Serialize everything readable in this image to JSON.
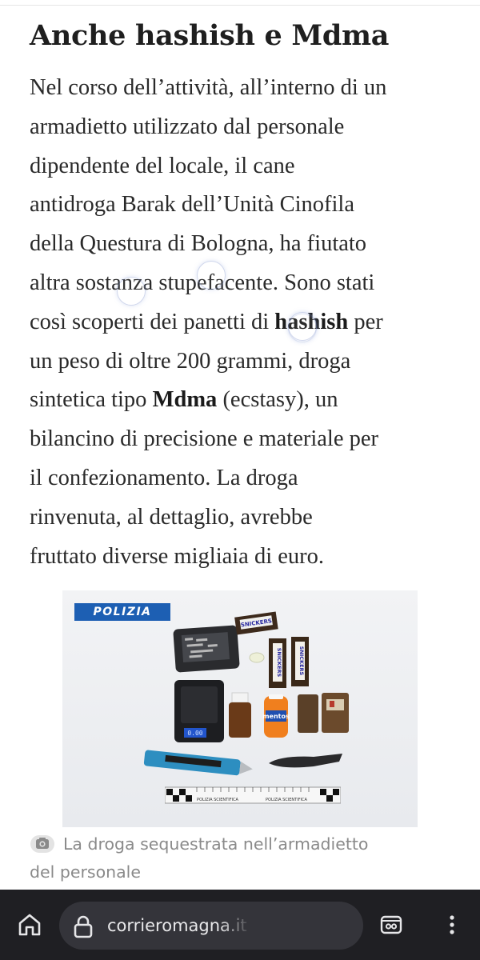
{
  "article": {
    "headline": "Anche hashish e Mdma",
    "lines": [
      {
        "parts": [
          {
            "t": "Nel corso dell’attività, all’interno di un"
          }
        ]
      },
      {
        "parts": [
          {
            "t": "armadietto utilizzato dal personale"
          }
        ]
      },
      {
        "parts": [
          {
            "t": "dipendente del locale, il cane"
          }
        ]
      },
      {
        "parts": [
          {
            "t": "antidroga Barak dell’Unità Cinofila"
          }
        ]
      },
      {
        "parts": [
          {
            "t": "della Questura di Bologna, ha fiutato"
          }
        ]
      },
      {
        "parts": [
          {
            "t": "altra sostanza stupefacente. Sono stati"
          }
        ]
      },
      {
        "parts": [
          {
            "t": "così scoperti dei panetti di "
          },
          {
            "t": "hashish",
            "b": true
          },
          {
            "t": " per"
          }
        ]
      },
      {
        "parts": [
          {
            "t": "un peso di oltre 200 grammi, droga"
          }
        ]
      },
      {
        "parts": [
          {
            "t": "sintetica tipo "
          },
          {
            "t": "Mdma",
            "b": true
          },
          {
            "t": " (ecstasy), un"
          }
        ]
      },
      {
        "parts": [
          {
            "t": "bilancino di precisione e materiale per"
          }
        ]
      },
      {
        "parts": [
          {
            "t": "il confezionamento. La droga"
          }
        ]
      },
      {
        "parts": [
          {
            "t": "rinvenuta, al dettaglio, avrebbe"
          }
        ]
      },
      {
        "parts": [
          {
            "t": "fruttato diverse migliaia di euro."
          }
        ]
      }
    ],
    "photo": {
      "badge": "POLIZIA",
      "ruler_text_left": "POLIZIA SCIENTIFICA",
      "ruler_text_right": "POLIZIA SCIENTIFICA",
      "scale_display": "0.00",
      "snickers_label": "SNICKERS",
      "mentos_label": "mentos"
    },
    "caption_line1": "La droga sequestrata nell’armadietto",
    "caption_line2": "del personale",
    "caption_icon": "camera-icon"
  },
  "browser": {
    "url": "corrieromagna.it",
    "icons": [
      "home-icon",
      "lock-icon",
      "reader-mode-icon",
      "translate-icon",
      "tab-switcher-icon",
      "more-menu-icon"
    ]
  }
}
